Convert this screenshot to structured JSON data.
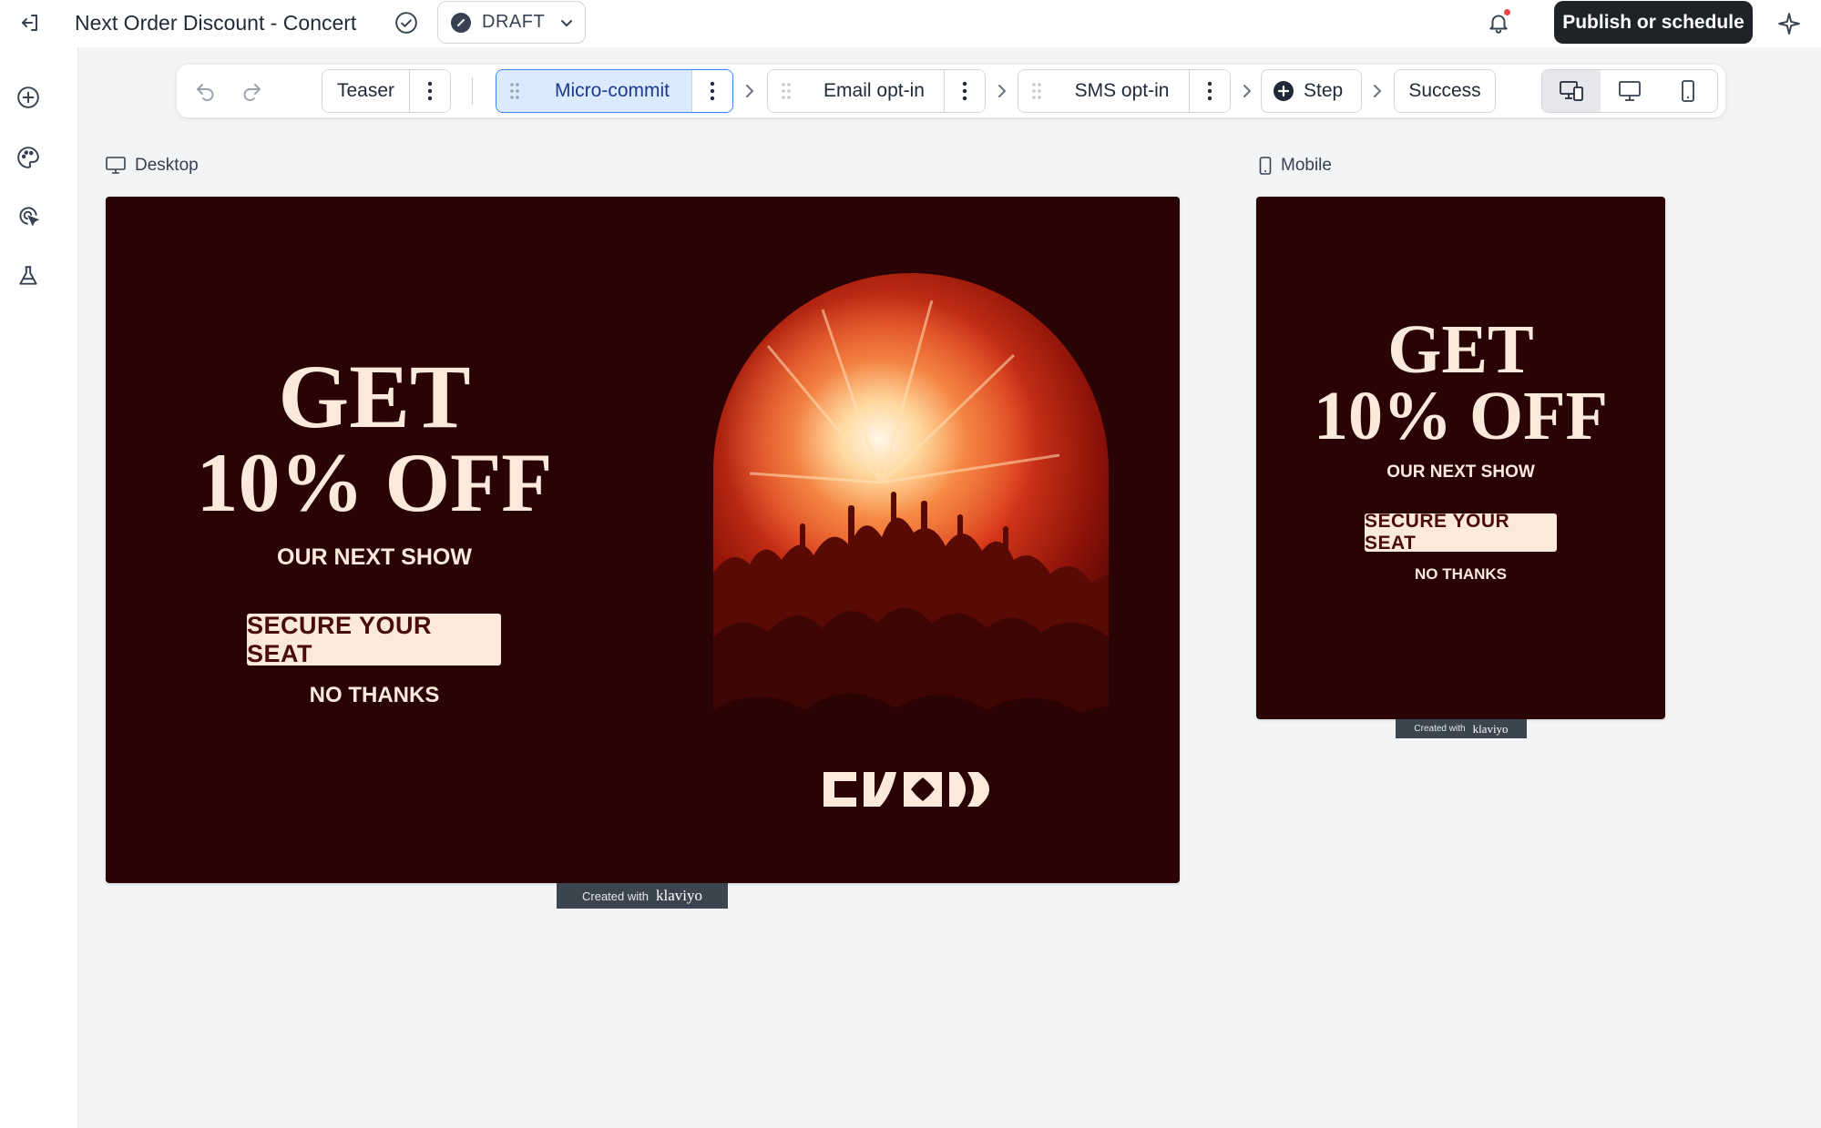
{
  "header": {
    "title": "Next Order Discount - Concert",
    "status": "DRAFT",
    "publish_label": "Publish or schedule"
  },
  "steps": [
    {
      "label": "Teaser"
    },
    {
      "label": "Micro-commit",
      "active": true
    },
    {
      "label": "Email opt-in"
    },
    {
      "label": "SMS opt-in"
    },
    {
      "label": "Step"
    },
    {
      "label": "Success"
    }
  ],
  "previews": {
    "desktop_label": "Desktop",
    "mobile_label": "Mobile"
  },
  "popup": {
    "headline_line1": "GET",
    "headline_line2": "10% OFF",
    "subhead": "OUR NEXT SHOW",
    "cta_label": "SECURE YOUR SEAT",
    "decline_label": "NO THANKS",
    "background_color": "#2a0404",
    "text_color": "#fbeadb"
  },
  "credit": {
    "prefix": "Created with",
    "brand": "klaviyo"
  },
  "icons": {
    "exit": "exit-icon",
    "verified": "check-circle-icon",
    "notifications": "bell-icon",
    "ai": "sparkle-icon",
    "rail": [
      "add-icon",
      "palette-icon",
      "target-icon",
      "beaker-icon"
    ]
  }
}
